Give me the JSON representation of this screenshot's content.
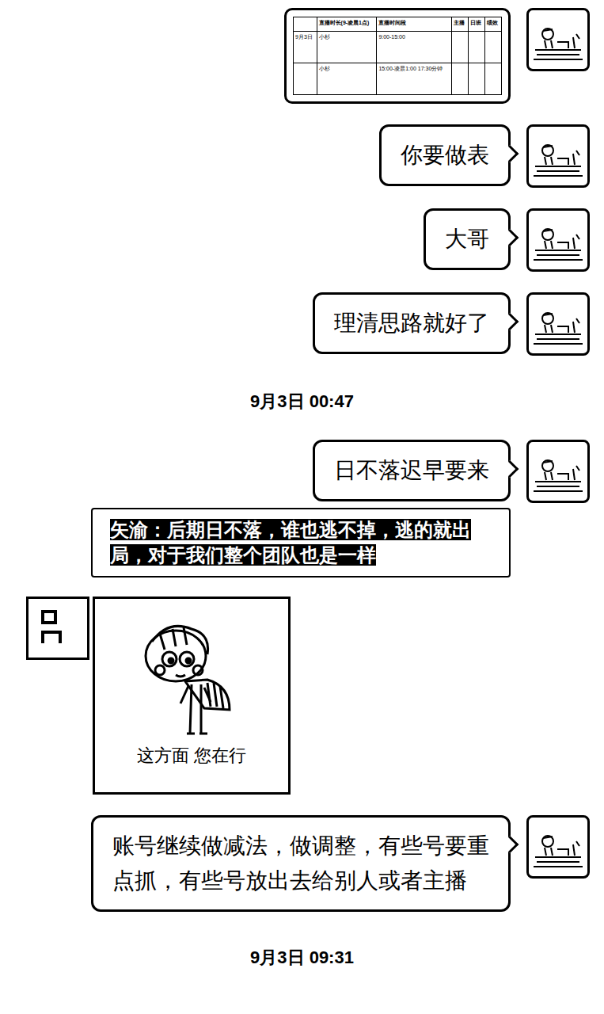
{
  "messages": [
    {
      "kind": "table-image",
      "side": "right",
      "table": {
        "columns": [
          "",
          "直播时长(9-凌晨1点)",
          "直播时间段",
          "主播",
          "日班",
          "绩效"
        ],
        "rows": [
          [
            "9月3日",
            "小杉",
            "9:00-15:00",
            "",
            "",
            ""
          ],
          [
            "",
            "小杉",
            "15:00-凌晨1:00 17:30分钟",
            "",
            "",
            ""
          ]
        ]
      }
    },
    {
      "kind": "text",
      "side": "right",
      "text": "你要做表"
    },
    {
      "kind": "text",
      "side": "right",
      "text": "大哥"
    },
    {
      "kind": "text",
      "side": "right",
      "text": "理清思路就好了"
    },
    {
      "kind": "timestamp",
      "side": "center",
      "text": "9月3日 00:47"
    },
    {
      "kind": "text",
      "side": "right",
      "text": "日不落迟早要来"
    },
    {
      "kind": "quote",
      "side": "right",
      "text": "矢渝：后期日不落，谁也逃不掉，逃的就出局，对于我们整个团队也是一样"
    },
    {
      "kind": "sticker",
      "side": "left",
      "caption": "这方面 您在行"
    },
    {
      "kind": "text",
      "side": "right",
      "text": "账号继续做减法，做调整，有些号要重点抓，有些号放出去给别人或者主播"
    },
    {
      "kind": "timestamp",
      "side": "center",
      "text": "9月3日 09:31"
    }
  ]
}
